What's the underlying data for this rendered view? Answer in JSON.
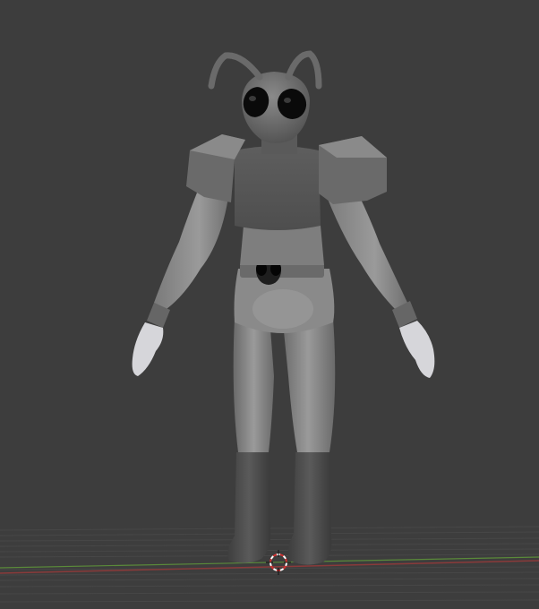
{
  "viewport": {
    "background_color": "#3d3d3d",
    "grid_color": "#474747",
    "x_axis_color": "#8a3a3a",
    "y_axis_color": "#5a8a3a",
    "cursor_colors": [
      "#ffffff",
      "#d03030"
    ]
  },
  "model": {
    "body_color": "#8c8c8c",
    "armor_color": "#6e6e6e",
    "glove_color": "#d8d8dc",
    "eye_color": "#0a0a0a",
    "icons": [
      "3d-cursor-icon"
    ]
  }
}
